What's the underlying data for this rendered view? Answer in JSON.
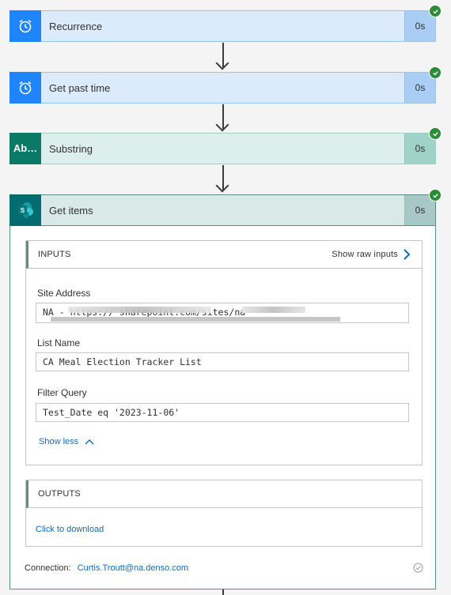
{
  "steps": [
    {
      "title": "Recurrence",
      "duration": "0s",
      "icon": "alarm-clock-icon"
    },
    {
      "title": "Get past time",
      "duration": "0s",
      "icon": "alarm-clock-icon"
    },
    {
      "title": "Substring",
      "duration": "0s",
      "icon_text": "Ab…"
    },
    {
      "title": "Get items",
      "duration": "0s",
      "icon_text": "S"
    }
  ],
  "inputs": {
    "heading": "INPUTS",
    "show_raw": "Show raw inputs",
    "site_label": "Site Address",
    "site_value": "NA - https://                    sharepoint.com/sites/na",
    "list_label": "List Name",
    "list_value": "CA Meal Election Tracker List",
    "filter_label": "Filter Query",
    "filter_value": "Test_Date eq '2023-11-06'",
    "show_less": "Show less"
  },
  "outputs": {
    "heading": "OUTPUTS",
    "download": "Click to download"
  },
  "connection": {
    "label": "Connection:",
    "value": "Curtis.Troutt@na.denso.com"
  },
  "colors": {
    "blue_accent": "#1f85ff",
    "teal_accent": "#0a7a66",
    "sharepoint": "#036c70",
    "success": "#2c8c37",
    "link": "#0f6cbd"
  }
}
